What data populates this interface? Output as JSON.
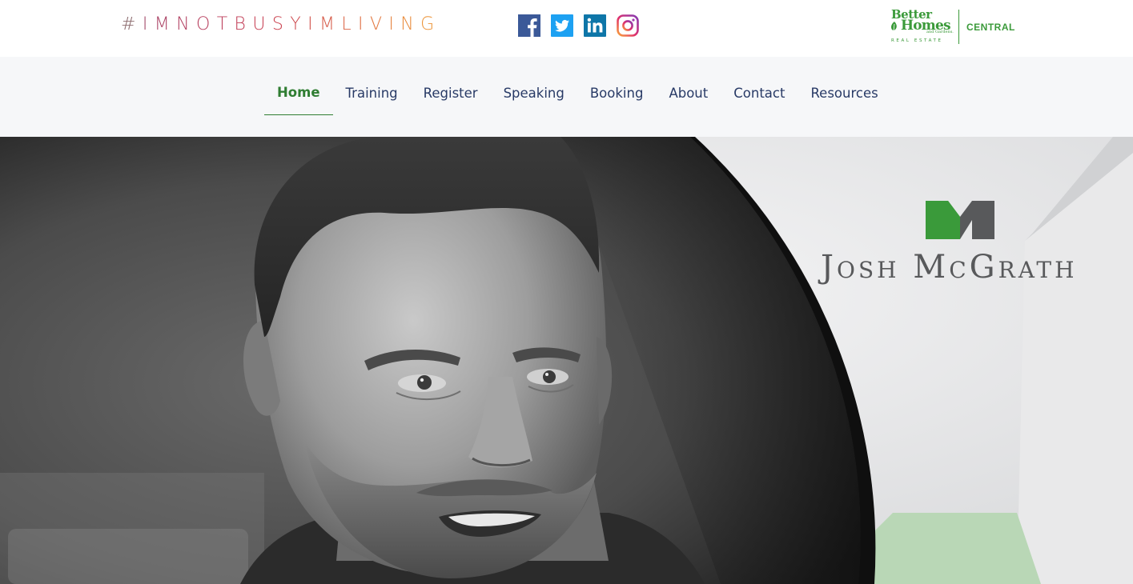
{
  "header": {
    "hashtag_chars": [
      "#",
      "I",
      "M",
      "N",
      "O",
      "T",
      "B",
      "U",
      "S",
      "Y",
      "I",
      "M",
      "L",
      "I",
      "V",
      "I",
      "N",
      "G"
    ],
    "hashtag_colors": [
      "#8c6b6e",
      "#a24a6a",
      "#ac4567",
      "#b34263",
      "#b8405f",
      "#bd3e5b",
      "#c23e57",
      "#c74054",
      "#cb4451",
      "#ce4a4f",
      "#d2534c",
      "#d65c4a",
      "#db6647",
      "#df7045",
      "#e37a42",
      "#e6833f",
      "#e98c3c",
      "#ec953a"
    ],
    "social": [
      {
        "name": "facebook-icon",
        "color": "#3b5998"
      },
      {
        "name": "twitter-icon",
        "color": "#1da1f2"
      },
      {
        "name": "linkedin-icon",
        "color": "#0e76a8"
      },
      {
        "name": "instagram-icon",
        "color": "#c13584"
      }
    ],
    "brand": {
      "better": "Better",
      "homes": "Homes",
      "gardens": "and Gardens.",
      "real_estate": "REAL ESTATE",
      "central": "CENTRAL",
      "color": "#3b9a3a"
    }
  },
  "nav": {
    "items": [
      {
        "label": "Home",
        "active": true
      },
      {
        "label": "Training",
        "active": false
      },
      {
        "label": "Register",
        "active": false
      },
      {
        "label": "Speaking",
        "active": false
      },
      {
        "label": "Booking",
        "active": false
      },
      {
        "label": "About",
        "active": false
      },
      {
        "label": "Contact",
        "active": false
      },
      {
        "label": "Resources",
        "active": false
      }
    ],
    "text_color": "#283a66",
    "active_color": "#2f7d32"
  },
  "hero": {
    "logo_name": "Josh McGrath",
    "logo_green": "#3a9a3a",
    "logo_gray": "#58595b",
    "accent_green": "#b9d7b6"
  }
}
